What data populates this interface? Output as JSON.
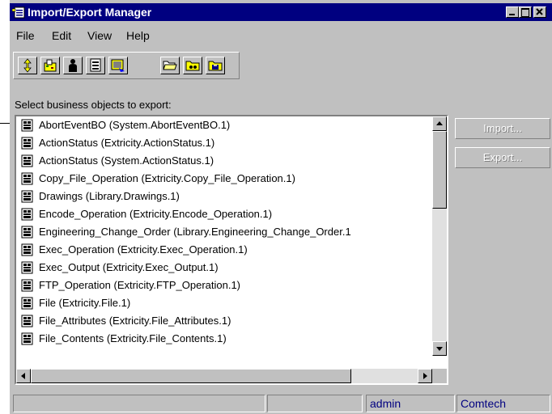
{
  "window": {
    "title": "Import/Export Manager"
  },
  "menu": [
    "File",
    "Edit",
    "View",
    "Help"
  ],
  "toolbar": {
    "icons": [
      "arrows-updown-icon",
      "business-objects-icon",
      "person-icon",
      "document-icon",
      "picture-icon",
      "open-folder-icon",
      "folder-view-icon",
      "folder-save-icon"
    ]
  },
  "list": {
    "label": "Select business objects to export:",
    "items": [
      "AbortEventBO  (System.AbortEventBO.1)",
      "ActionStatus  (Extricity.ActionStatus.1)",
      "ActionStatus  (System.ActionStatus.1)",
      "Copy_File_Operation  (Extricity.Copy_File_Operation.1)",
      "Drawings  (Library.Drawings.1)",
      "Encode_Operation  (Extricity.Encode_Operation.1)",
      "Engineering_Change_Order  (Library.Engineering_Change_Order.1",
      "Exec_Operation  (Extricity.Exec_Operation.1)",
      "Exec_Output  (Extricity.Exec_Output.1)",
      "FTP_Operation  (Extricity.FTP_Operation.1)",
      "File  (Extricity.File.1)",
      "File_Attributes  (Extricity.File_Attributes.1)",
      "File_Contents  (Extricity.File_Contents.1)"
    ]
  },
  "buttons": {
    "import": "Import...",
    "export": "Export..."
  },
  "status": {
    "user": "admin",
    "org": "Comtech"
  },
  "colors": {
    "titlebar": "#000080",
    "face": "#c0c0c0",
    "status_text": "#000080"
  }
}
